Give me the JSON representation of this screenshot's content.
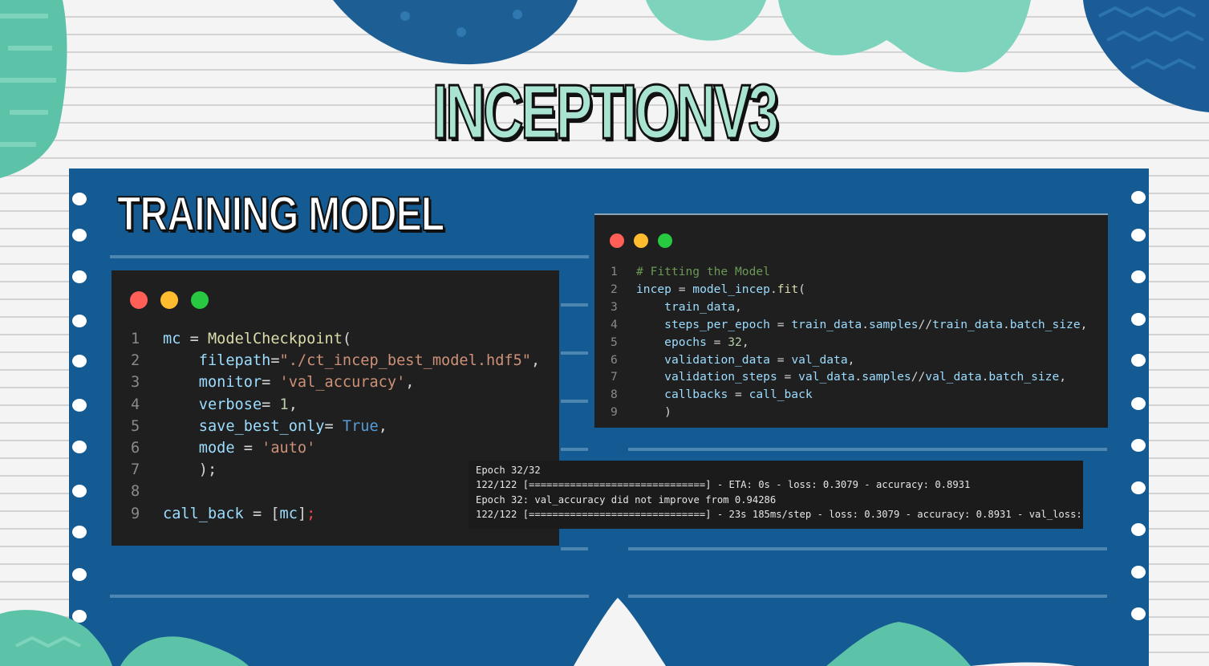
{
  "title": "INCEPTIONV3",
  "subtitle": "TRAINING MODEL",
  "colors": {
    "background": "#f4f4f4",
    "board": "#155b93",
    "title_fill": "#a9e3d2",
    "window": "#1f1f1f",
    "dot_red": "#ff5f57",
    "dot_yellow": "#febc2e",
    "dot_green": "#28c840"
  },
  "left_code": {
    "lines": [
      {
        "n": "1",
        "parts": [
          [
            "k-var",
            "mc"
          ],
          [
            "k-op",
            " = "
          ],
          [
            "k-fn",
            "ModelCheckpoint"
          ],
          [
            "k-op",
            "("
          ]
        ]
      },
      {
        "n": "2",
        "parts": [
          [
            "k-op",
            "    "
          ],
          [
            "k-var",
            "filepath"
          ],
          [
            "k-op",
            "="
          ],
          [
            "k-str",
            "\"./ct_incep_best_model.hdf5\""
          ],
          [
            "k-op",
            ","
          ]
        ]
      },
      {
        "n": "3",
        "parts": [
          [
            "k-op",
            "    "
          ],
          [
            "k-var",
            "monitor"
          ],
          [
            "k-op",
            "= "
          ],
          [
            "k-str",
            "'val_accuracy'"
          ],
          [
            "k-op",
            ","
          ]
        ]
      },
      {
        "n": "4",
        "parts": [
          [
            "k-op",
            "    "
          ],
          [
            "k-var",
            "verbose"
          ],
          [
            "k-op",
            "= "
          ],
          [
            "k-num",
            "1"
          ],
          [
            "k-op",
            ","
          ]
        ]
      },
      {
        "n": "5",
        "parts": [
          [
            "k-op",
            "    "
          ],
          [
            "k-var",
            "save_best_only"
          ],
          [
            "k-op",
            "= "
          ],
          [
            "k-kw",
            "True"
          ],
          [
            "k-op",
            ","
          ]
        ]
      },
      {
        "n": "6",
        "parts": [
          [
            "k-op",
            "    "
          ],
          [
            "k-var",
            "mode"
          ],
          [
            "k-op",
            " = "
          ],
          [
            "k-str",
            "'auto'"
          ]
        ]
      },
      {
        "n": "7",
        "parts": [
          [
            "k-op",
            "    );"
          ]
        ]
      },
      {
        "n": "8",
        "parts": []
      },
      {
        "n": "9",
        "parts": [
          [
            "k-var",
            "call_back"
          ],
          [
            "k-op",
            " = ["
          ],
          [
            "k-var",
            "mc"
          ],
          [
            "k-op",
            "]"
          ],
          [
            "k-red",
            ";"
          ]
        ]
      }
    ]
  },
  "right_code": {
    "lines": [
      {
        "n": "1",
        "parts": [
          [
            "k-cm",
            "# Fitting the Model"
          ]
        ]
      },
      {
        "n": "2",
        "parts": [
          [
            "k-var",
            "incep"
          ],
          [
            "k-op",
            " = "
          ],
          [
            "k-var",
            "model_incep"
          ],
          [
            "k-op",
            "."
          ],
          [
            "k-fn",
            "fit"
          ],
          [
            "k-op",
            "("
          ]
        ]
      },
      {
        "n": "3",
        "parts": [
          [
            "k-op",
            "    "
          ],
          [
            "k-var",
            "train_data"
          ],
          [
            "k-op",
            ","
          ]
        ]
      },
      {
        "n": "4",
        "parts": [
          [
            "k-op",
            "    "
          ],
          [
            "k-var",
            "steps_per_epoch"
          ],
          [
            "k-op",
            " = "
          ],
          [
            "k-var",
            "train_data"
          ],
          [
            "k-op",
            "."
          ],
          [
            "k-var",
            "samples"
          ],
          [
            "k-op",
            "//"
          ],
          [
            "k-var",
            "train_data"
          ],
          [
            "k-op",
            "."
          ],
          [
            "k-var",
            "batch_size"
          ],
          [
            "k-op",
            ","
          ]
        ]
      },
      {
        "n": "5",
        "parts": [
          [
            "k-op",
            "    "
          ],
          [
            "k-var",
            "epochs"
          ],
          [
            "k-op",
            " = "
          ],
          [
            "k-num",
            "32"
          ],
          [
            "k-op",
            ","
          ]
        ]
      },
      {
        "n": "6",
        "parts": [
          [
            "k-op",
            "    "
          ],
          [
            "k-var",
            "validation_data"
          ],
          [
            "k-op",
            " = "
          ],
          [
            "k-var",
            "val_data"
          ],
          [
            "k-op",
            ","
          ]
        ]
      },
      {
        "n": "7",
        "parts": [
          [
            "k-op",
            "    "
          ],
          [
            "k-var",
            "validation_steps"
          ],
          [
            "k-op",
            " = "
          ],
          [
            "k-var",
            "val_data"
          ],
          [
            "k-op",
            "."
          ],
          [
            "k-var",
            "samples"
          ],
          [
            "k-op",
            "//"
          ],
          [
            "k-var",
            "val_data"
          ],
          [
            "k-op",
            "."
          ],
          [
            "k-var",
            "batch_size"
          ],
          [
            "k-op",
            ","
          ]
        ]
      },
      {
        "n": "8",
        "parts": [
          [
            "k-op",
            "    "
          ],
          [
            "k-var",
            "callbacks"
          ],
          [
            "k-op",
            " = "
          ],
          [
            "k-var",
            "call_back"
          ]
        ]
      },
      {
        "n": "9",
        "parts": [
          [
            "k-op",
            "    )"
          ]
        ]
      }
    ]
  },
  "terminal": {
    "lines": [
      "Epoch 32/32",
      "122/122 [==============================] - ETA: 0s - loss: 0.3079 - accuracy: 0.8931",
      "Epoch 32: val_accuracy did not improve from 0.94286",
      "122/122 [==============================] - 23s 185ms/step - loss: 0.3079 - accuracy: 0.8931 - val_loss:"
    ]
  }
}
